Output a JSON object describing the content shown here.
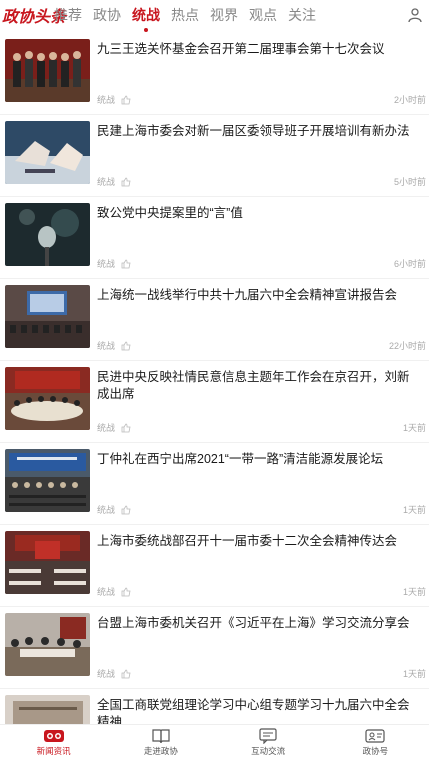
{
  "header": {
    "logo": "政协头条",
    "tabs": [
      "推荐",
      "政协",
      "统战",
      "热点",
      "视界",
      "观点",
      "关注"
    ],
    "active_tab": 2
  },
  "news": [
    {
      "title": "九三王选关怀基金会召开第二届理事会第十七次会议",
      "source": "统战",
      "time": "2小时前"
    },
    {
      "title": "民建上海市委会对新一届区委领导班子开展培训有新办法",
      "source": "统战",
      "time": "5小时前"
    },
    {
      "title": "致公党中央提案里的“言”值",
      "source": "统战",
      "time": "6小时前"
    },
    {
      "title": "上海统一战线举行中共十九届六中全会精神宣讲报告会",
      "source": "统战",
      "time": "22小时前"
    },
    {
      "title": "民进中央反映社情民意信息主题年工作会在京召开，刘新成出席",
      "source": "统战",
      "time": "1天前"
    },
    {
      "title": "丁仲礼在西宁出席2021“一带一路”清洁能源发展论坛",
      "source": "统战",
      "time": "1天前"
    },
    {
      "title": "上海市委统战部召开十一届市委十二次全会精神传达会",
      "source": "统战",
      "time": "1天前"
    },
    {
      "title": "台盟上海市委机关召开《习近平在上海》学习交流分享会",
      "source": "统战",
      "time": "1天前"
    },
    {
      "title": "全国工商联党组理论学习中心组专题学习十九届六中全会精神",
      "source": "",
      "time": ""
    }
  ],
  "bottom_nav": [
    {
      "label": "新闻资讯",
      "icon": "news-glasses-icon",
      "active": true
    },
    {
      "label": "走进政协",
      "icon": "book-icon",
      "active": false
    },
    {
      "label": "互动交流",
      "icon": "chat-icon",
      "active": false
    },
    {
      "label": "政协号",
      "icon": "id-card-icon",
      "active": false
    }
  ],
  "colors": {
    "accent": "#c8161e",
    "muted": "#aaaaaa"
  }
}
